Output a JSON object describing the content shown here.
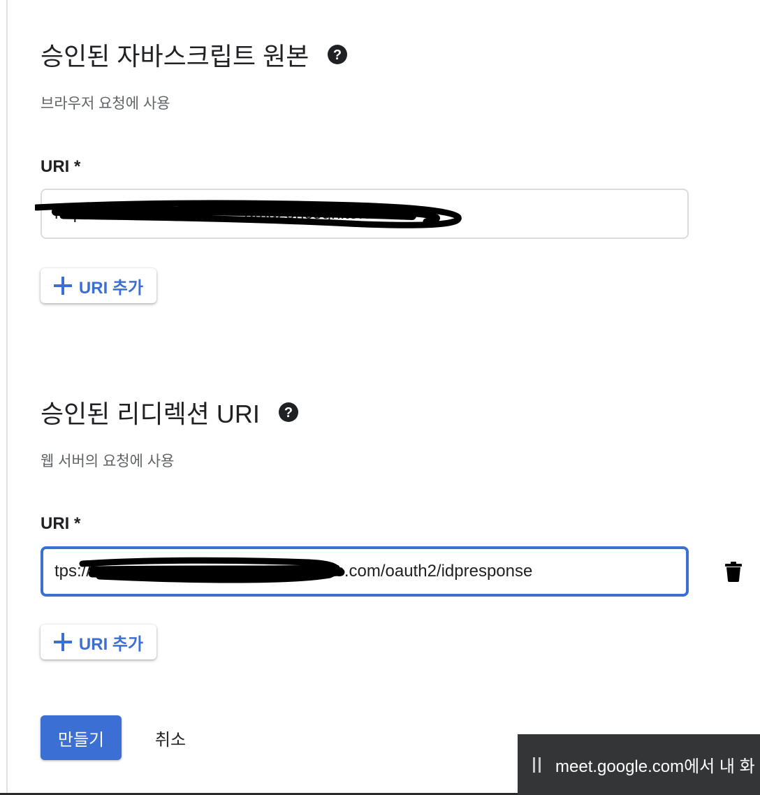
{
  "js_origins": {
    "title": "승인된 자바스크립트 원본",
    "subtitle": "브라우저 요청에 사용",
    "uri_label": "URI *",
    "uri_value": "https://                              amazoncognito.com",
    "add_button_label": "URI 추가",
    "help_icon": "help-circle-icon"
  },
  "redirect_uris": {
    "title": "승인된 리디렉션 URI",
    "subtitle": "웹 서버의 요청에 사용",
    "uri_label": "URI *",
    "uri_value": "tps://                              amazoncognito.com/oauth2/idpresponse",
    "add_button_label": "URI 추가",
    "help_icon": "help-circle-icon",
    "delete_icon": "trash-icon"
  },
  "actions": {
    "create_label": "만들기",
    "cancel_label": "취소"
  },
  "share_banner": {
    "text": "meet.google.com에서 내 화",
    "icon": "pause-icon"
  },
  "colors": {
    "accent": "#3c6fd4",
    "text": "#202124",
    "muted": "#5f6368",
    "border": "#dadce0",
    "banner": "#333537"
  }
}
